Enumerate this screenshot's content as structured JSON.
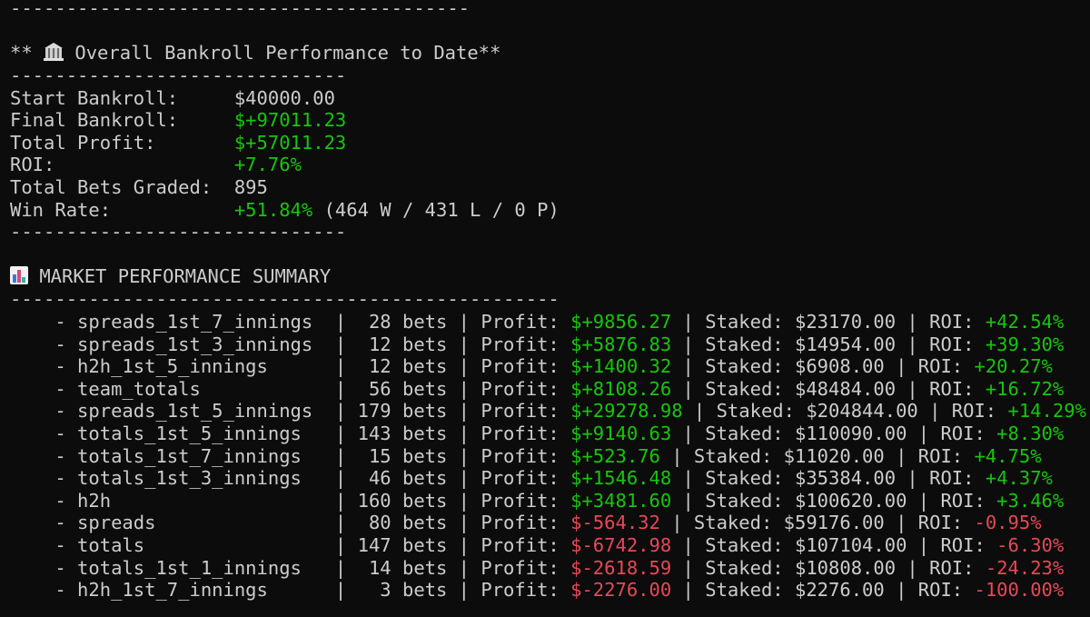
{
  "rules": {
    "top": "-----------------------------------------",
    "short": "------------------------------",
    "long": "-------------------------------------------------"
  },
  "bankroll": {
    "heading_prefix": "** ",
    "heading_text": " Overall Bankroll Performance to Date**",
    "heading_icon": "bank-icon",
    "rows": [
      {
        "label": "Start Bankroll:     ",
        "value": "$40000.00",
        "value_color": "default",
        "suffix": ""
      },
      {
        "label": "Final Bankroll:     ",
        "value": "$+97011.23",
        "value_color": "green",
        "suffix": ""
      },
      {
        "label": "Total Profit:       ",
        "value": "$+57011.23",
        "value_color": "green",
        "suffix": ""
      },
      {
        "label": "ROI:                ",
        "value": "+7.76%",
        "value_color": "green",
        "suffix": ""
      },
      {
        "label": "Total Bets Graded:  ",
        "value": "895",
        "value_color": "default",
        "suffix": ""
      },
      {
        "label": "Win Rate:           ",
        "value": "+51.84%",
        "value_color": "green",
        "suffix": " (464 W / 431 L / 0 P)"
      }
    ]
  },
  "market": {
    "heading_icon": "bar-chart-icon",
    "heading_text": " MARKET PERFORMANCE SUMMARY",
    "sep": " | ",
    "profit_label": "Profit: ",
    "staked_label": "Staked: ",
    "roi_label": "ROI: ",
    "rows": [
      {
        "name": "    - spreads_1st_7_innings  ",
        "bets": "|  28 bets",
        "profit": "$+9856.27",
        "profit_color": "green",
        "staked": "$23170.00",
        "roi": "+42.54%",
        "roi_color": "green"
      },
      {
        "name": "    - spreads_1st_3_innings  ",
        "bets": "|  12 bets",
        "profit": "$+5876.83",
        "profit_color": "green",
        "staked": "$14954.00",
        "roi": "+39.30%",
        "roi_color": "green"
      },
      {
        "name": "    - h2h_1st_5_innings      ",
        "bets": "|  12 bets",
        "profit": "$+1400.32",
        "profit_color": "green",
        "staked": "$6908.00",
        "roi": "+20.27%",
        "roi_color": "green"
      },
      {
        "name": "    - team_totals            ",
        "bets": "|  56 bets",
        "profit": "$+8108.26",
        "profit_color": "green",
        "staked": "$48484.00",
        "roi": "+16.72%",
        "roi_color": "green"
      },
      {
        "name": "    - spreads_1st_5_innings  ",
        "bets": "| 179 bets",
        "profit": "$+29278.98",
        "profit_color": "green",
        "staked": "$204844.00",
        "roi": "+14.29%",
        "roi_color": "green"
      },
      {
        "name": "    - totals_1st_5_innings   ",
        "bets": "| 143 bets",
        "profit": "$+9140.63",
        "profit_color": "green",
        "staked": "$110090.00",
        "roi": "+8.30%",
        "roi_color": "green"
      },
      {
        "name": "    - totals_1st_7_innings   ",
        "bets": "|  15 bets",
        "profit": "$+523.76",
        "profit_color": "green",
        "staked": "$11020.00",
        "roi": "+4.75%",
        "roi_color": "green"
      },
      {
        "name": "    - totals_1st_3_innings   ",
        "bets": "|  46 bets",
        "profit": "$+1546.48",
        "profit_color": "green",
        "staked": "$35384.00",
        "roi": "+4.37%",
        "roi_color": "green"
      },
      {
        "name": "    - h2h                    ",
        "bets": "| 160 bets",
        "profit": "$+3481.60",
        "profit_color": "green",
        "staked": "$100620.00",
        "roi": "+3.46%",
        "roi_color": "green"
      },
      {
        "name": "    - spreads                ",
        "bets": "|  80 bets",
        "profit": "$-564.32",
        "profit_color": "red",
        "staked": "$59176.00",
        "roi": "-0.95%",
        "roi_color": "red"
      },
      {
        "name": "    - totals                 ",
        "bets": "| 147 bets",
        "profit": "$-6742.98",
        "profit_color": "red",
        "staked": "$107104.00",
        "roi": "-6.30%",
        "roi_color": "red"
      },
      {
        "name": "    - totals_1st_1_innings   ",
        "bets": "|  14 bets",
        "profit": "$-2618.59",
        "profit_color": "red",
        "staked": "$10808.00",
        "roi": "-24.23%",
        "roi_color": "red"
      },
      {
        "name": "    - h2h_1st_7_innings      ",
        "bets": "|   3 bets",
        "profit": "$-2276.00",
        "profit_color": "red",
        "staked": "$2276.00",
        "roi": "-100.00%",
        "roi_color": "red"
      }
    ]
  }
}
